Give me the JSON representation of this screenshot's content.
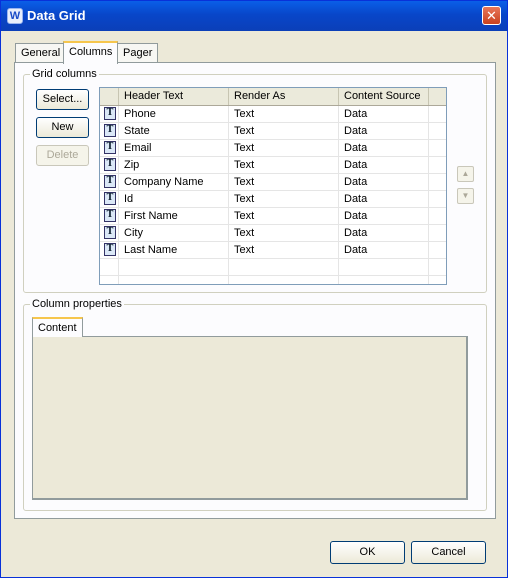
{
  "window": {
    "title": "Data Grid",
    "icon": "app-logo-icon"
  },
  "tabs": [
    {
      "label": "General",
      "active": false
    },
    {
      "label": "Columns",
      "active": true
    },
    {
      "label": "Pager",
      "active": false
    }
  ],
  "grid_columns": {
    "legend": "Grid columns",
    "buttons": {
      "select": "Select...",
      "new": "New",
      "delete": "Delete"
    },
    "headers": [
      "Header Text",
      "Render As",
      "Content Source"
    ],
    "rows": [
      {
        "header": "Phone",
        "render": "Text",
        "source": "Data"
      },
      {
        "header": "State",
        "render": "Text",
        "source": "Data"
      },
      {
        "header": "Email",
        "render": "Text",
        "source": "Data"
      },
      {
        "header": "Zip",
        "render": "Text",
        "source": "Data"
      },
      {
        "header": "Company Name",
        "render": "Text",
        "source": "Data"
      },
      {
        "header": "Id",
        "render": "Text",
        "source": "Data"
      },
      {
        "header": "First Name",
        "render": "Text",
        "source": "Data"
      },
      {
        "header": "City",
        "render": "Text",
        "source": "Data"
      },
      {
        "header": "Last Name",
        "render": "Text",
        "source": "Data"
      }
    ],
    "row_icon_glyph": "T"
  },
  "column_properties": {
    "legend": "Column properties",
    "tab": "Content"
  },
  "footer": {
    "ok": "OK",
    "cancel": "Cancel"
  }
}
